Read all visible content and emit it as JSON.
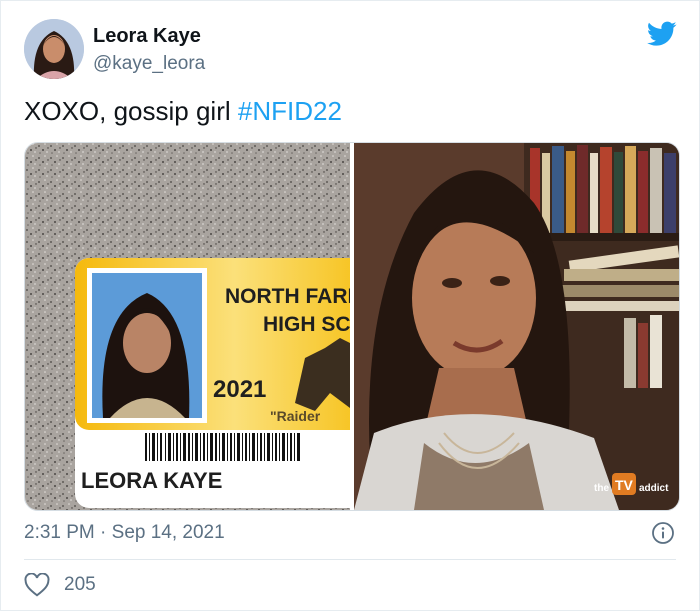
{
  "author": {
    "name": "Leora Kaye",
    "handle": "@kaye_leora"
  },
  "tweet": {
    "text": "XOXO, gossip girl ",
    "hashtag": "#NFID22"
  },
  "id_card": {
    "school_line1": "NORTH FARM",
    "school_line2": "HIGH SC",
    "year": "2021",
    "mascot": "\"Raider",
    "student_name": "LEORA KAYE"
  },
  "watermark": {
    "prefix": "the",
    "logo": "TV",
    "suffix": "addict"
  },
  "meta": {
    "timestamp": "2:31 PM · Sep 14, 2021"
  },
  "stats": {
    "likes": "205"
  },
  "colors": {
    "link": "#1da1f2",
    "secondary": "#5b7083",
    "card_yellow": "#f6c21c"
  },
  "icons": {
    "brand": "twitter-bird-icon",
    "info": "info-icon",
    "like": "heart-icon"
  }
}
